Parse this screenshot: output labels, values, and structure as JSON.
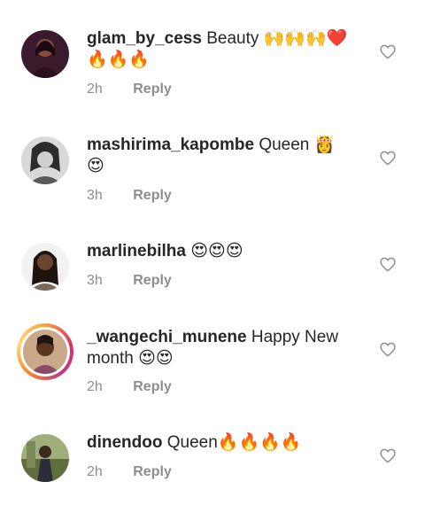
{
  "comments": [
    {
      "username": "glam_by_cess",
      "text": "Beauty",
      "emojis_line1": "🙌🙌🙌❤️",
      "emojis_line2": "🔥🔥🔥",
      "time": "2h",
      "reply_label": "Reply",
      "story_ring": false
    },
    {
      "username": "mashirima_kapombe",
      "text": "Queen",
      "emojis_line1": "👸",
      "emojis_line2": "😍",
      "time": "3h",
      "reply_label": "Reply",
      "story_ring": false
    },
    {
      "username": "marlinebilha",
      "text": "",
      "emojis_line1": "😍😍😍",
      "emojis_line2": "",
      "time": "3h",
      "reply_label": "Reply",
      "story_ring": false
    },
    {
      "username": "_wangechi_munene",
      "text": "Happy New",
      "text_line2": "month",
      "emojis_line2": "😍😍",
      "time": "2h",
      "reply_label": "Reply",
      "story_ring": true
    },
    {
      "username": "dinendoo",
      "text": "Queen",
      "emojis_line1": "🔥🔥🔥🔥",
      "time": "2h",
      "reply_label": "Reply",
      "story_ring": false
    }
  ],
  "colors": {
    "text": "#262626",
    "meta": "#8e8e8e",
    "heart_stroke": "#8e8e8e"
  },
  "icons": {
    "like": "heart-outline-icon"
  }
}
